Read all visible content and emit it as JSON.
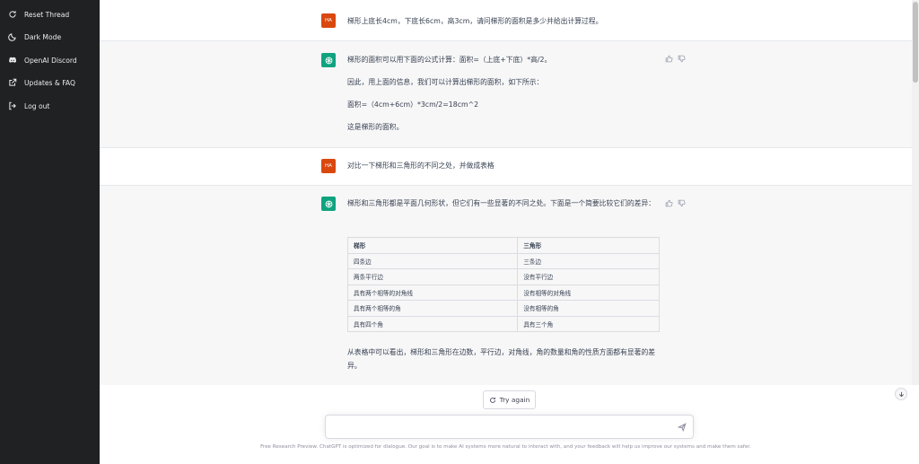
{
  "sidebar": {
    "items": [
      {
        "label": "Reset Thread",
        "icon": "refresh-icon"
      },
      {
        "label": "Dark Mode",
        "icon": "moon-icon"
      },
      {
        "label": "OpenAI Discord",
        "icon": "discord-icon"
      },
      {
        "label": "Updates & FAQ",
        "icon": "external-link-icon"
      },
      {
        "label": "Log out",
        "icon": "logout-icon"
      }
    ]
  },
  "conversation": {
    "user_avatar_text": "HA",
    "msg1_user": "梯形上底长4cm，下底长6cm，高3cm，请问梯形的面积是多少并给出计算过程。",
    "msg2_bot": [
      "梯形的面积可以用下面的公式计算：面积=（上底+下底）*高/2。",
      "因此，用上面的信息，我们可以计算出梯形的面积，如下所示：",
      "面积=（4cm+6cm）*3cm/2=18cm^2",
      "这是梯形的面积。"
    ],
    "msg3_user": "对比一下梯形和三角形的不同之处，并做成表格",
    "msg4_bot_intro": "梯形和三角形都是平面几何形状，但它们有一些显著的不同之处。下面是一个简要比较它们的差异：",
    "table": {
      "headers": [
        "梯形",
        "三角形"
      ],
      "rows": [
        [
          "四条边",
          "三条边"
        ],
        [
          "两条平行边",
          "没有平行边"
        ],
        [
          "具有两个相等的对角线",
          "没有相等的对角线"
        ],
        [
          "具有两个相等的角",
          "没有相等的角"
        ],
        [
          "具有四个角",
          "具有三个角"
        ]
      ]
    },
    "msg4_bot_outro": "从表格中可以看出，梯形和三角形在边数，平行边，对角线，角的数量和角的性质方面都有显著的差异。"
  },
  "controls": {
    "try_again": "Try again",
    "input_value": "",
    "input_placeholder": ""
  },
  "footer": "Free Research Preview. ChatGPT is optimized for dialogue. Our goal is to make AI systems more natural to interact with, and your feedback will help us improve our systems and make them safer.",
  "colors": {
    "sidebar_bg": "#202123",
    "bot_row_bg": "#f7f7f8",
    "bot_avatar": "#10a37f",
    "user_avatar": "#d9480f"
  }
}
